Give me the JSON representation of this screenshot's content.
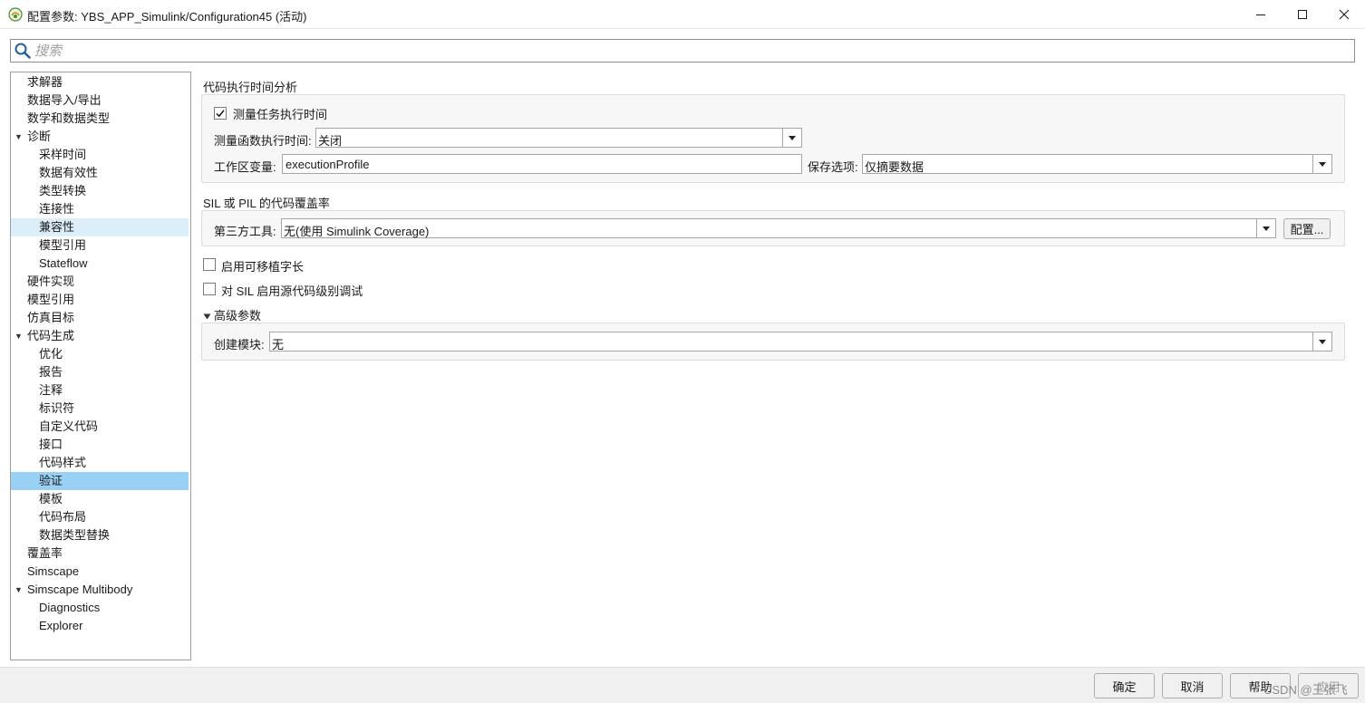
{
  "window": {
    "title": "配置参数: YBS_APP_Simulink/Configuration45 (活动)",
    "icon": "simulink-model-icon",
    "controls": [
      "minimize-icon",
      "maximize-icon",
      "close-icon"
    ]
  },
  "search": {
    "placeholder": "搜索",
    "value": ""
  },
  "sidebar": {
    "items": [
      {
        "label": "求解器",
        "level": 0
      },
      {
        "label": "数据导入/导出",
        "level": 0
      },
      {
        "label": "数学和数据类型",
        "level": 0
      },
      {
        "label": "诊断",
        "level": 0,
        "expanded": true
      },
      {
        "label": "采样时间",
        "level": 1
      },
      {
        "label": "数据有效性",
        "level": 1
      },
      {
        "label": "类型转换",
        "level": 1
      },
      {
        "label": "连接性",
        "level": 1
      },
      {
        "label": "兼容性",
        "level": 1,
        "highlight": "hover"
      },
      {
        "label": "模型引用",
        "level": 1
      },
      {
        "label": "Stateflow",
        "level": 1
      },
      {
        "label": "硬件实现",
        "level": 0
      },
      {
        "label": "模型引用",
        "level": 0
      },
      {
        "label": "仿真目标",
        "level": 0
      },
      {
        "label": "代码生成",
        "level": 0,
        "expanded": true
      },
      {
        "label": "优化",
        "level": 1
      },
      {
        "label": "报告",
        "level": 1
      },
      {
        "label": "注释",
        "level": 1
      },
      {
        "label": "标识符",
        "level": 1
      },
      {
        "label": "自定义代码",
        "level": 1
      },
      {
        "label": "接口",
        "level": 1
      },
      {
        "label": "代码样式",
        "level": 1
      },
      {
        "label": "验证",
        "level": 1,
        "highlight": "selected"
      },
      {
        "label": "模板",
        "level": 1
      },
      {
        "label": "代码布局",
        "level": 1
      },
      {
        "label": "数据类型替换",
        "level": 1
      },
      {
        "label": "覆盖率",
        "level": 0
      },
      {
        "label": "Simscape",
        "level": 0
      },
      {
        "label": "Simscape Multibody",
        "level": 0,
        "expanded": true
      },
      {
        "label": "Diagnostics",
        "level": 1
      },
      {
        "label": "Explorer",
        "level": 1
      }
    ]
  },
  "content": {
    "profiling": {
      "title": "代码执行时间分析",
      "measure_task_label": "测量任务执行时间",
      "measure_task_checked": true,
      "measure_func_label": "测量函数执行时间:",
      "measure_func_value": "关闭",
      "workspace_var_label": "工作区变量:",
      "workspace_var_value": "executionProfile",
      "save_option_label": "保存选项:",
      "save_option_value": "仅摘要数据"
    },
    "coverage": {
      "title": "SIL 或 PIL 的代码覆盖率",
      "third_party_label": "第三方工具:",
      "third_party_value": "无(使用 Simulink Coverage)",
      "config_button": "配置..."
    },
    "portable_word_sizes_label": "启用可移植字长",
    "portable_word_sizes_checked": false,
    "sil_debug_label": "对 SIL 启用源代码级别调试",
    "sil_debug_checked": false,
    "advanced": {
      "title": "高级参数",
      "expanded": true,
      "create_block_label": "创建模块:",
      "create_block_value": "无"
    }
  },
  "footer": {
    "ok": "确定",
    "cancel": "取消",
    "help": "帮助",
    "apply": "应用",
    "watermark": "CSDN @王张飞"
  },
  "colors": {
    "selected": "#99d1f5",
    "hover": "#dbeefa",
    "accent_icon": "#0f6fc6"
  }
}
